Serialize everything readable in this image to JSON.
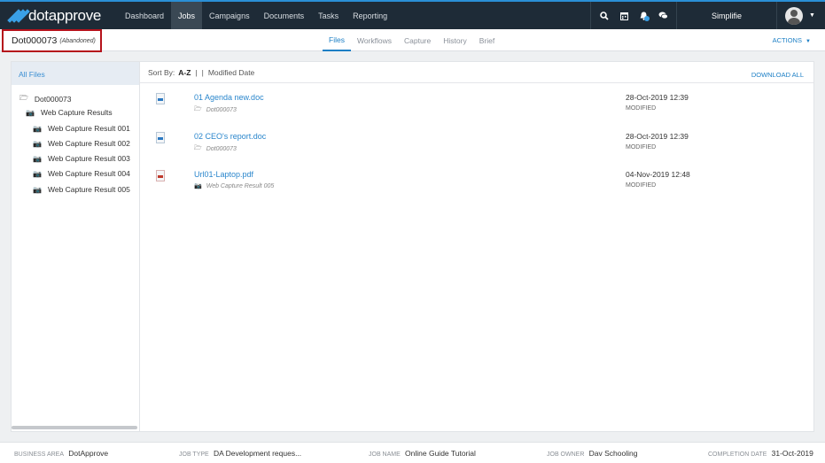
{
  "app": {
    "brand": "dotapprove",
    "accent": "#2a8fd6"
  },
  "nav": {
    "items": [
      "Dashboard",
      "Jobs",
      "Campaigns",
      "Documents",
      "Tasks",
      "Reporting"
    ],
    "active": "Jobs"
  },
  "top_icons": [
    "search-icon",
    "calendar-icon",
    "bell-icon",
    "chat-icon"
  ],
  "user": {
    "company": "Simplifie"
  },
  "job": {
    "id": "Dot000073",
    "status": "(Abandoned)"
  },
  "tabs": [
    "Files",
    "Workflows",
    "Capture",
    "History",
    "Brief"
  ],
  "actions_label": "ACTIONS",
  "sidebar": {
    "all_files": "All Files",
    "tree": [
      {
        "label": "Dot000073",
        "icon": "folder-open-icon"
      },
      {
        "label": "Web Capture Results",
        "icon": "camera-icon"
      },
      {
        "label": "Web Capture Result 001",
        "icon": "camera-icon"
      },
      {
        "label": "Web Capture Result 002",
        "icon": "camera-icon"
      },
      {
        "label": "Web Capture Result 003",
        "icon": "camera-icon"
      },
      {
        "label": "Web Capture Result 004",
        "icon": "camera-icon"
      },
      {
        "label": "Web Capture Result 005",
        "icon": "camera-icon"
      }
    ]
  },
  "sort": {
    "label": "Sort By:",
    "selected": "A-Z",
    "separator": "|",
    "separator2": "|",
    "other": "Modified Date"
  },
  "download_all": "DOWNLOAD ALL",
  "files": [
    {
      "name": "01 Agenda new.doc",
      "type": "doc",
      "location": "Dot000073",
      "location_icon": "folder-open-icon",
      "date": "28-Oct-2019 12:39",
      "status": "MODIFIED"
    },
    {
      "name": "02 CEO's report.doc",
      "type": "doc",
      "location": "Dot000073",
      "location_icon": "folder-open-icon",
      "date": "28-Oct-2019 12:39",
      "status": "MODIFIED"
    },
    {
      "name": "Url01-Laptop.pdf",
      "type": "pdf",
      "location": "Web Capture Result 005",
      "location_icon": "camera-icon",
      "date": "04-Nov-2019 12:48",
      "status": "MODIFIED"
    }
  ],
  "footer": {
    "business_area": {
      "label": "BUSINESS AREA",
      "value": "DotApprove"
    },
    "job_type": {
      "label": "JOB TYPE",
      "value": "DA Development reques..."
    },
    "job_name": {
      "label": "JOB NAME",
      "value": "Online Guide Tutorial"
    },
    "job_owner": {
      "label": "JOB OWNER",
      "value": "Dav Schooling"
    },
    "completion_date": {
      "label": "COMPLETION DATE",
      "value": "31-Oct-2019"
    }
  }
}
